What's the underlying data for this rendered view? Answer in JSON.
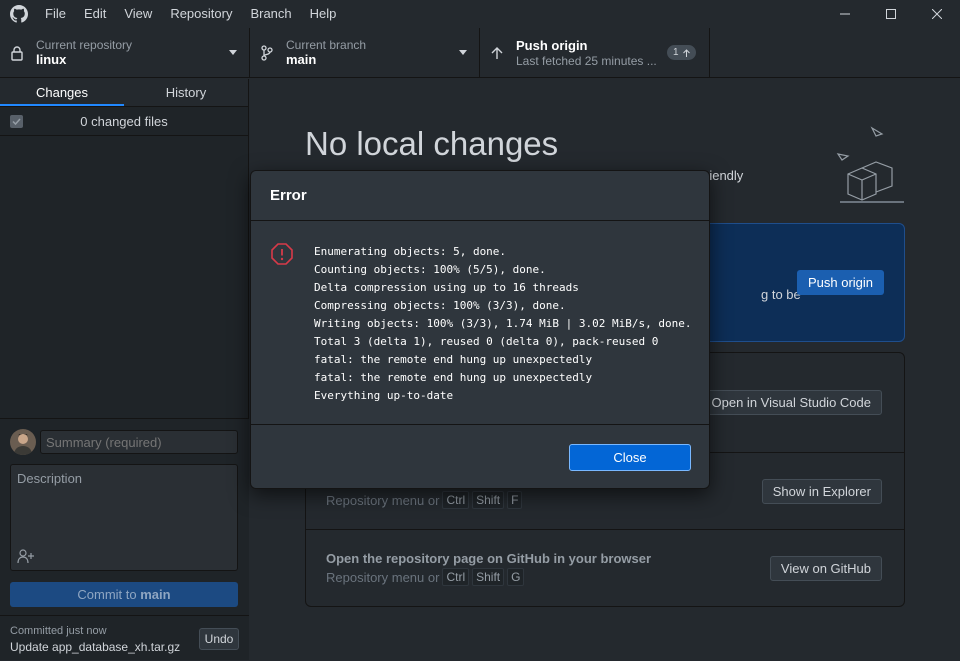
{
  "titlebar": {
    "menu": [
      "File",
      "Edit",
      "View",
      "Repository",
      "Branch",
      "Help"
    ]
  },
  "toolbar": {
    "repo": {
      "label": "Current repository",
      "value": "linux"
    },
    "branch": {
      "label": "Current branch",
      "value": "main"
    },
    "push": {
      "label": "Push origin",
      "sub": "Last fetched 25 minutes ...",
      "badge": "1"
    }
  },
  "sidebar": {
    "tabs": [
      "Changes",
      "History"
    ],
    "changed_files": "0 changed files",
    "summary_placeholder": "Summary (required)",
    "description_placeholder": "Description",
    "commit_prefix": "Commit to",
    "commit_branch": "main",
    "recent_time": "Committed just now",
    "recent_msg": "Update app_database_xh.tar.gz",
    "undo": "Undo"
  },
  "main": {
    "title": "No local changes",
    "subtitle_tail": "riendly",
    "push_card_text": "g to be",
    "push_card_btn": "Push origin",
    "actions": [
      {
        "title": "",
        "sub": "",
        "keys": [],
        "button": "Open in Visual Studio Code"
      },
      {
        "title": "",
        "sub": "Repository menu or",
        "keys": [
          "Ctrl",
          "Shift",
          "F"
        ],
        "button": "Show in Explorer"
      },
      {
        "title": "Open the repository page on GitHub in your browser",
        "sub": "Repository menu or",
        "keys": [
          "Ctrl",
          "Shift",
          "G"
        ],
        "button": "View on GitHub"
      }
    ]
  },
  "modal": {
    "title": "Error",
    "log": [
      "Enumerating objects: 5, done.",
      "Counting objects: 100% (5/5), done.",
      "Delta compression using up to 16 threads",
      "Compressing objects: 100% (3/3), done.",
      "Writing objects: 100% (3/3), 1.74 MiB | 3.02 MiB/s, done.",
      "Total 3 (delta 1), reused 0 (delta 0), pack-reused 0",
      "fatal: the remote end hung up unexpectedly",
      "fatal: the remote end hung up unexpectedly",
      "Everything up-to-date"
    ],
    "close": "Close"
  },
  "colors": {
    "accent": "#0366d6",
    "error": "#d73a49",
    "background": "#24292e"
  }
}
